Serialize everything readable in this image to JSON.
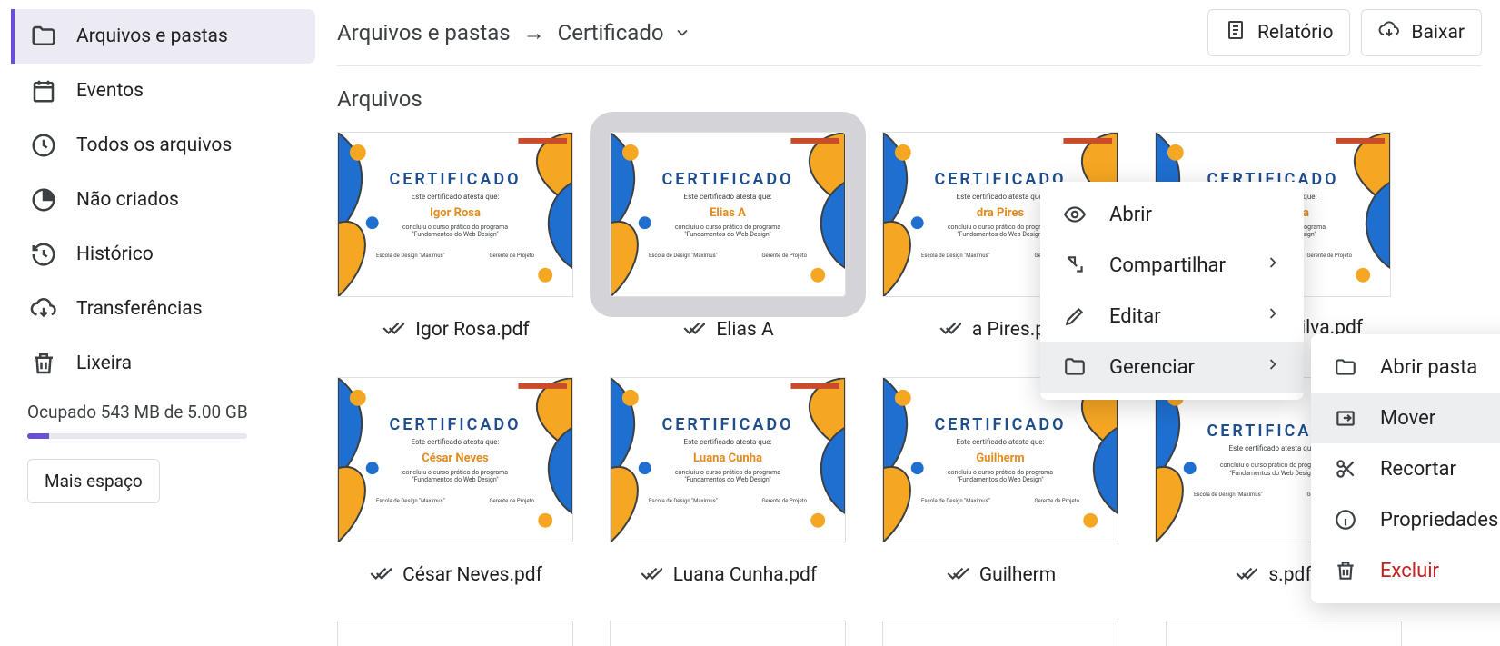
{
  "sidebar": {
    "items": [
      {
        "label": "Arquivos e pastas",
        "icon": "folder"
      },
      {
        "label": "Eventos",
        "icon": "calendar"
      },
      {
        "label": "Todos os arquivos",
        "icon": "clock"
      },
      {
        "label": "Não criados",
        "icon": "pie"
      },
      {
        "label": "Histórico",
        "icon": "history"
      },
      {
        "label": "Transferências",
        "icon": "download-cloud"
      },
      {
        "label": "Lixeira",
        "icon": "trash"
      }
    ],
    "storage_text": "Ocupado 543 MB de 5.00 GB",
    "storage_pct": 10,
    "more_btn": "Mais espaço"
  },
  "breadcrumb": {
    "root": "Arquivos e pastas",
    "current": "Certificado"
  },
  "topbar": {
    "report": "Relatório",
    "download": "Baixar"
  },
  "section_title": "Arquivos",
  "certificate_text": {
    "title": "CERTIFICADO",
    "subtitle": "Este certificado atesta que:",
    "body1": "concluiu o curso prático do programa",
    "body2": "\"Fundamentos do Web Design\"",
    "foot_left": "Escola de Design \"Maximus\"",
    "foot_right": "Gerente de Projeto"
  },
  "files": [
    {
      "name": "Igor Rosa",
      "filename": "Igor Rosa.pdf",
      "status": "ok"
    },
    {
      "name": "Elias A",
      "filename": "Elias A",
      "status": "ok",
      "selected": true
    },
    {
      "name": "dra Pires",
      "filename": "a Pires.pdf",
      "status": "ok"
    },
    {
      "name": "Amanda Silva",
      "filename": "Amanda Silva.pdf",
      "status": "error"
    },
    {
      "name": "César Neves",
      "filename": "César Neves.pdf",
      "status": "ok"
    },
    {
      "name": "Luana Cunha",
      "filename": "Luana Cunha.pdf",
      "status": "ok"
    },
    {
      "name": "Guilherm",
      "filename": "Guilherm",
      "status": "ok"
    },
    {
      "name": "",
      "filename": "s.pdf",
      "status": "ok"
    }
  ],
  "context_menu": [
    {
      "label": "Abrir",
      "icon": "eye"
    },
    {
      "label": "Compartilhar",
      "icon": "share",
      "submenu": true
    },
    {
      "label": "Editar",
      "icon": "pencil",
      "submenu": true
    },
    {
      "label": "Gerenciar",
      "icon": "folder",
      "submenu": true,
      "hover": true
    }
  ],
  "submenu": [
    {
      "label": "Abrir pasta",
      "icon": "folder-outline"
    },
    {
      "label": "Mover",
      "icon": "move-folder",
      "hover": true
    },
    {
      "label": "Recortar",
      "icon": "scissors"
    },
    {
      "label": "Propriedades do arquivo",
      "icon": "info"
    },
    {
      "label": "Excluir",
      "icon": "trash",
      "danger": true
    }
  ]
}
